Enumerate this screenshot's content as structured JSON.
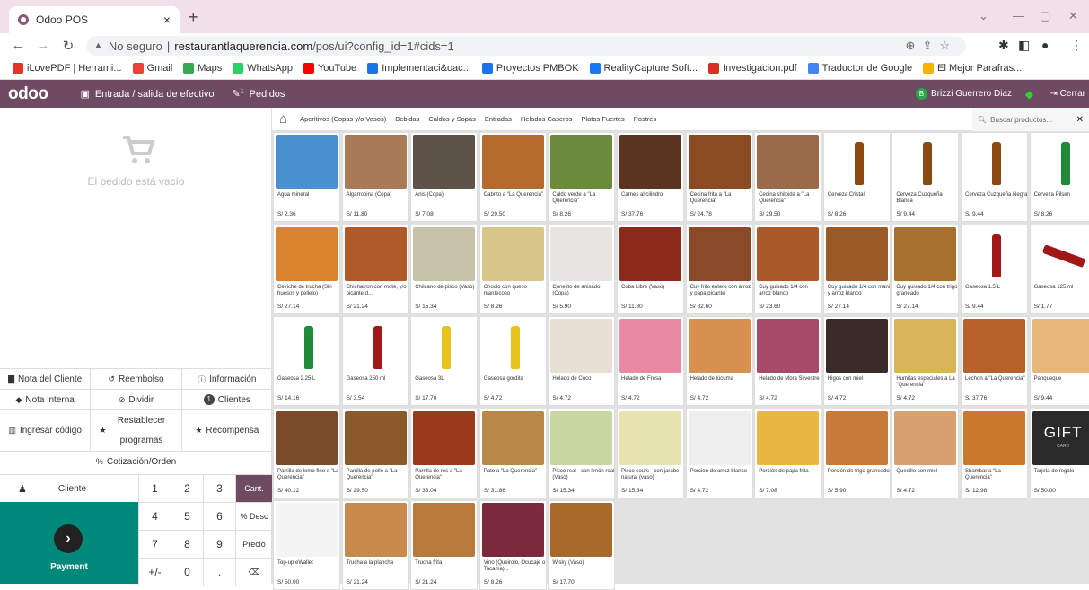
{
  "browser": {
    "tab_title": "Odoo POS",
    "url_prefix": "No seguro",
    "url_host": "restaurantlaquerencia.com",
    "url_path": "/pos/ui?config_id=1#cids=1",
    "bookmarks": [
      {
        "label": "iLovePDF | Herrami...",
        "color": "#e5322d"
      },
      {
        "label": "Gmail",
        "color": "#ea4335"
      },
      {
        "label": "Maps",
        "color": "#34a853"
      },
      {
        "label": "WhatsApp",
        "color": "#25d366"
      },
      {
        "label": "YouTube",
        "color": "#ff0000"
      },
      {
        "label": "Implementaci&oac...",
        "color": "#1a73e8"
      },
      {
        "label": "Proyectos PMBOK",
        "color": "#1a73e8"
      },
      {
        "label": "RealityCapture Soft...",
        "color": "#1877f2"
      },
      {
        "label": "Investigacion.pdf",
        "color": "#d93025"
      },
      {
        "label": "Traductor de Google",
        "color": "#4285f4"
      },
      {
        "label": "El Mejor Parafras...",
        "color": "#f4b400"
      }
    ]
  },
  "pos": {
    "logo": "odoo",
    "cash_in_out": "Entrada / salida de efectivo",
    "orders": "Pedidos",
    "orders_badge": "1",
    "user": "Brizzi Guerrero Diaz",
    "user_initial": "B",
    "close": "Cerrar",
    "empty_order": "El pedido está vacío",
    "controls": [
      [
        {
          "label": "Nota del Cliente",
          "icon": "note-icon"
        },
        {
          "label": "Reembolso",
          "icon": "undo-icon"
        },
        {
          "label": "Información",
          "icon": "info-icon"
        }
      ],
      [
        {
          "label": "Nota interna",
          "icon": "tag-icon"
        },
        {
          "label": "Dividir",
          "icon": "split-icon"
        },
        {
          "label": "Clientes",
          "icon": "count-icon",
          "badge": "1"
        }
      ],
      [
        {
          "label": "Ingresar código",
          "icon": "barcode-icon"
        },
        {
          "label": "Restablecer programas",
          "icon": "star-icon"
        },
        {
          "label": "Recompensa",
          "icon": "star-icon"
        }
      ]
    ],
    "quote": "Cotización/Orden",
    "customer": "Cliente",
    "payment": "Payment",
    "numpad": [
      [
        "1",
        "2",
        "3",
        "Cant."
      ],
      [
        "4",
        "5",
        "6",
        "% Desc"
      ],
      [
        "7",
        "8",
        "9",
        "Precio"
      ],
      [
        "+/-",
        "0",
        ".",
        "⌫"
      ]
    ],
    "categories": [
      "Aperitivos (Copas y/o Vasos)",
      "Bebidas",
      "Caldos y Sopas",
      "Entradas",
      "Helados Caseros",
      "Platos Fuertes",
      "Postres"
    ],
    "search_placeholder": "Buscar productos..."
  },
  "products": [
    {
      "name": "Agua mineral",
      "price": "S/ 2.36",
      "color": "#4a8fd0"
    },
    {
      "name": "Algarrobina (Copa)",
      "price": "S/ 11.80",
      "color": "#a87a55"
    },
    {
      "name": "Anis (Copa)",
      "price": "S/ 7.08",
      "color": "#5c5248"
    },
    {
      "name": "Cabrito a \"La Querencia\"",
      "price": "S/ 29.50",
      "color": "#b56a2e"
    },
    {
      "name": "Caldo verde a \"La Querencia\"",
      "price": "S/ 8.26",
      "color": "#6b8a3a"
    },
    {
      "name": "Carnes al cilindro",
      "price": "S/ 37.76",
      "color": "#5a3420"
    },
    {
      "name": "Cecina frita a \"La Querencia\"",
      "price": "S/ 24.78",
      "color": "#8a4a22"
    },
    {
      "name": "Cecina shilpida a \"La Querencia\"",
      "price": "S/ 29.50",
      "color": "#9a6a4a"
    },
    {
      "name": "Cerveza Cristal",
      "price": "S/ 8.26",
      "color": "#ffffff"
    },
    {
      "name": "Cerveza Cuzqueña Blanca",
      "price": "S/ 9.44",
      "color": "#ffffff"
    },
    {
      "name": "Cerveza Cuzqueña Negra",
      "price": "S/ 9.44",
      "color": "#ffffff"
    },
    {
      "name": "Cerveza Pilsen",
      "price": "S/ 8.26",
      "color": "#ffffff"
    },
    {
      "name": "Ceviche de trucha (Sin huesos y pellejo)",
      "price": "S/ 27.14",
      "color": "#d8842e"
    },
    {
      "name": "Chicharron con mote, y/o picante d...",
      "price": "S/ 21.24",
      "color": "#b05a2a"
    },
    {
      "name": "Chilcano de pisco (Vaso)",
      "price": "S/ 15.34",
      "color": "#c8c2a8"
    },
    {
      "name": "Choclo con queso mantecoso",
      "price": "S/ 8.26",
      "color": "#d8c68a"
    },
    {
      "name": "Conejito de anisado (Copa)",
      "price": "S/ 5.90",
      "color": "#e8e4e2"
    },
    {
      "name": "Cuba Libre (Vaso)",
      "price": "S/ 11.80",
      "color": "#8a2a1a"
    },
    {
      "name": "Cuy frito entero con arroz y papa picante",
      "price": "S/ 82.60",
      "color": "#8a4a2a"
    },
    {
      "name": "Cuy guisado 1/4 con arroz blanco",
      "price": "S/ 23.60",
      "color": "#a85a2a"
    },
    {
      "name": "Cuy guisado 1/4 con mani y arroz blanco",
      "price": "S/ 27.14",
      "color": "#9a5a28"
    },
    {
      "name": "Cuy guisado 1/4 con trigo graneado",
      "price": "S/ 27.14",
      "color": "#a8702e"
    },
    {
      "name": "Gaseosa 1.5 L",
      "price": "S/ 9.44",
      "color": "#ffffff"
    },
    {
      "name": "Gaseosa 125 ml",
      "price": "S/ 1.77",
      "color": "#ffffff"
    },
    {
      "name": "Gaseosa 2.25 L",
      "price": "S/ 14.16",
      "color": "#ffffff"
    },
    {
      "name": "Gaseosa 250 ml",
      "price": "S/ 3.54",
      "color": "#ffffff"
    },
    {
      "name": "Gaseosa 3L",
      "price": "S/ 17.70",
      "color": "#ffffff"
    },
    {
      "name": "Gaseosa gordita",
      "price": "S/ 4.72",
      "color": "#ffffff"
    },
    {
      "name": "Helado de Coco",
      "price": "S/ 4.72",
      "color": "#e8e0d4"
    },
    {
      "name": "Helado de Fresa",
      "price": "S/ 4.72",
      "color": "#e88aa2"
    },
    {
      "name": "Helado de lúcuma",
      "price": "S/ 4.72",
      "color": "#d89050"
    },
    {
      "name": "Helado de Mora Silvestre",
      "price": "S/ 4.72",
      "color": "#a84a6a"
    },
    {
      "name": "Higos con miel",
      "price": "S/ 4.72",
      "color": "#3a2a2a"
    },
    {
      "name": "Humitas especiales a La \"Querencia\"",
      "price": "S/ 4.72",
      "color": "#d8b45a"
    },
    {
      "name": "Lechon a \"La Querencia\"",
      "price": "S/ 37.76",
      "color": "#b8602a"
    },
    {
      "name": "Panqueque",
      "price": "S/ 9.44",
      "color": "#e8b87a"
    },
    {
      "name": "Parrilla de lomo fino a \"La Querencia\"",
      "price": "S/ 40.12",
      "color": "#7a4a2a"
    },
    {
      "name": "Parrilla de pollo a \"La Querencia\"",
      "price": "S/ 29.50",
      "color": "#8a5a2a"
    },
    {
      "name": "Parrilla de res a \"La Querencia\"",
      "price": "S/ 33.04",
      "color": "#9a3a1a"
    },
    {
      "name": "Pato a \"La Querencia\"",
      "price": "S/ 31.86",
      "color": "#b88a4a"
    },
    {
      "name": "Pisco real - con limón real (Vaso)",
      "price": "S/ 15.34",
      "color": "#c8d8a0"
    },
    {
      "name": "Pisco sours - con jarabe natural (vaso)",
      "price": "S/ 15.34",
      "color": "#e8e4b0"
    },
    {
      "name": "Porcion de arroz blanco",
      "price": "S/ 4.72",
      "color": "#eeeeee"
    },
    {
      "name": "Porción de papa frita",
      "price": "S/ 7.08",
      "color": "#e8b840"
    },
    {
      "name": "Porción de trigo graneado",
      "price": "S/ 5.90",
      "color": "#c87a3a"
    },
    {
      "name": "Quesillo con miel",
      "price": "S/ 4.72",
      "color": "#d8a070"
    },
    {
      "name": "Shambar a \"La Querencia\"",
      "price": "S/ 12.98",
      "color": "#c87a2a"
    },
    {
      "name": "Tarjeta de regalo",
      "price": "S/ 50.00",
      "color": "#2a2a2a",
      "overlay": "GIFT",
      "overlay_sub": "CARD"
    },
    {
      "name": "Top-up eWallet",
      "price": "S/ 50.00",
      "color": "#f4f4f4"
    },
    {
      "name": "Trucha a la plancha",
      "price": "S/ 21.24",
      "color": "#c88a4a"
    },
    {
      "name": "Trucha frita",
      "price": "S/ 21.24",
      "color": "#b87a3a"
    },
    {
      "name": "Vino (Queirolo, Ocucaje o Tacama)...",
      "price": "S/ 8.26",
      "color": "#7a2a3a"
    },
    {
      "name": "Wisky (Vaso)",
      "price": "S/ 17.70",
      "color": "#a86a2a"
    }
  ]
}
